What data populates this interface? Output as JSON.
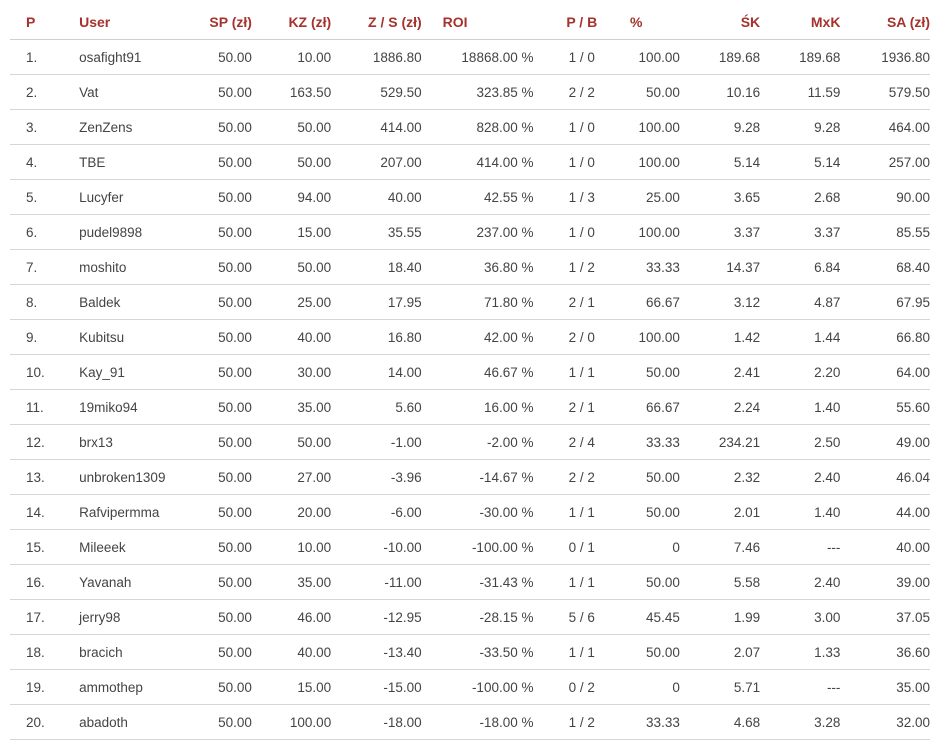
{
  "table": {
    "headers": [
      "P",
      "User",
      "SP (zł)",
      "KZ (zł)",
      "Z / S (zł)",
      "ROI",
      "P / B",
      "%",
      "ŚK",
      "MxK",
      "SA (zł)"
    ],
    "rows": [
      [
        "1.",
        "osafight91",
        "50.00",
        "10.00",
        "1886.80",
        "18868.00 %",
        "1 / 0",
        "100.00",
        "189.68",
        "189.68",
        "1936.80"
      ],
      [
        "2.",
        "Vat",
        "50.00",
        "163.50",
        "529.50",
        "323.85 %",
        "2 / 2",
        "50.00",
        "10.16",
        "11.59",
        "579.50"
      ],
      [
        "3.",
        "ZenZens",
        "50.00",
        "50.00",
        "414.00",
        "828.00 %",
        "1 / 0",
        "100.00",
        "9.28",
        "9.28",
        "464.00"
      ],
      [
        "4.",
        "TBE",
        "50.00",
        "50.00",
        "207.00",
        "414.00 %",
        "1 / 0",
        "100.00",
        "5.14",
        "5.14",
        "257.00"
      ],
      [
        "5.",
        "Lucyfer",
        "50.00",
        "94.00",
        "40.00",
        "42.55 %",
        "1 / 3",
        "25.00",
        "3.65",
        "2.68",
        "90.00"
      ],
      [
        "6.",
        "pudel9898",
        "50.00",
        "15.00",
        "35.55",
        "237.00 %",
        "1 / 0",
        "100.00",
        "3.37",
        "3.37",
        "85.55"
      ],
      [
        "7.",
        "moshito",
        "50.00",
        "50.00",
        "18.40",
        "36.80 %",
        "1 / 2",
        "33.33",
        "14.37",
        "6.84",
        "68.40"
      ],
      [
        "8.",
        "Baldek",
        "50.00",
        "25.00",
        "17.95",
        "71.80 %",
        "2 / 1",
        "66.67",
        "3.12",
        "4.87",
        "67.95"
      ],
      [
        "9.",
        "Kubitsu",
        "50.00",
        "40.00",
        "16.80",
        "42.00 %",
        "2 / 0",
        "100.00",
        "1.42",
        "1.44",
        "66.80"
      ],
      [
        "10.",
        "Kay_91",
        "50.00",
        "30.00",
        "14.00",
        "46.67 %",
        "1 / 1",
        "50.00",
        "2.41",
        "2.20",
        "64.00"
      ],
      [
        "11.",
        "19miko94",
        "50.00",
        "35.00",
        "5.60",
        "16.00 %",
        "2 / 1",
        "66.67",
        "2.24",
        "1.40",
        "55.60"
      ],
      [
        "12.",
        "brx13",
        "50.00",
        "50.00",
        "-1.00",
        "-2.00 %",
        "2 / 4",
        "33.33",
        "234.21",
        "2.50",
        "49.00"
      ],
      [
        "13.",
        "unbroken1309",
        "50.00",
        "27.00",
        "-3.96",
        "-14.67 %",
        "2 / 2",
        "50.00",
        "2.32",
        "2.40",
        "46.04"
      ],
      [
        "14.",
        "Rafvipermma",
        "50.00",
        "20.00",
        "-6.00",
        "-30.00 %",
        "1 / 1",
        "50.00",
        "2.01",
        "1.40",
        "44.00"
      ],
      [
        "15.",
        "Mileeek",
        "50.00",
        "10.00",
        "-10.00",
        "-100.00 %",
        "0 / 1",
        "0",
        "7.46",
        "---",
        "40.00"
      ],
      [
        "16.",
        "Yavanah",
        "50.00",
        "35.00",
        "-11.00",
        "-31.43 %",
        "1 / 1",
        "50.00",
        "5.58",
        "2.40",
        "39.00"
      ],
      [
        "17.",
        "jerry98",
        "50.00",
        "46.00",
        "-12.95",
        "-28.15 %",
        "5 / 6",
        "45.45",
        "1.99",
        "3.00",
        "37.05"
      ],
      [
        "18.",
        "bracich",
        "50.00",
        "40.00",
        "-13.40",
        "-33.50 %",
        "1 / 1",
        "50.00",
        "2.07",
        "1.33",
        "36.60"
      ],
      [
        "19.",
        "ammothep",
        "50.00",
        "15.00",
        "-15.00",
        "-100.00 %",
        "0 / 2",
        "0",
        "5.71",
        "---",
        "35.00"
      ],
      [
        "20.",
        "abadoth",
        "50.00",
        "100.00",
        "-18.00",
        "-18.00 %",
        "1 / 2",
        "33.33",
        "4.68",
        "3.28",
        "32.00"
      ]
    ]
  },
  "colors": {
    "header_text": "#a5322d",
    "body_text": "#444444",
    "row_border": "#d6d6d6"
  }
}
